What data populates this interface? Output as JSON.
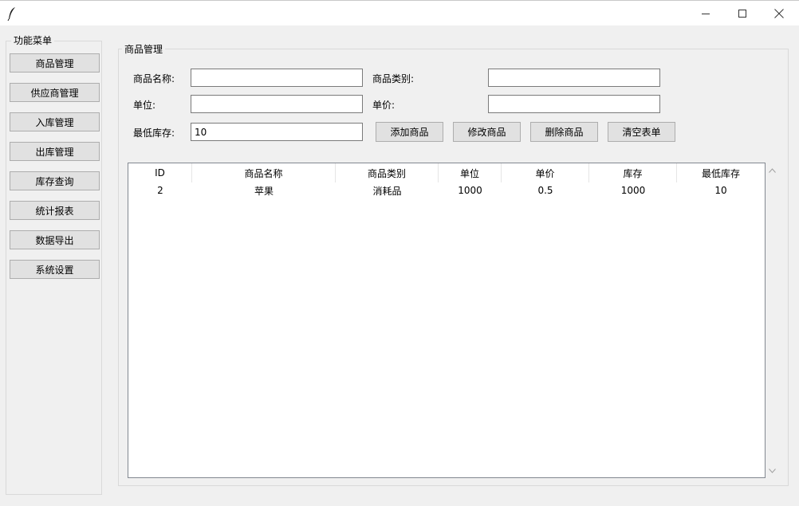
{
  "window": {
    "icon": "feather-icon",
    "minimize_icon": "minimize-icon",
    "maximize_icon": "maximize-icon",
    "close_icon": "close-icon"
  },
  "sidebar": {
    "title": "功能菜单",
    "items": [
      {
        "label": "商品管理"
      },
      {
        "label": "供应商管理"
      },
      {
        "label": "入库管理"
      },
      {
        "label": "出库管理"
      },
      {
        "label": "库存查询"
      },
      {
        "label": "统计报表"
      },
      {
        "label": "数据导出"
      },
      {
        "label": "系统设置"
      }
    ]
  },
  "main": {
    "title": "商品管理",
    "form": {
      "name_label": "商品名称:",
      "name_value": "",
      "category_label": "商品类别:",
      "category_value": "",
      "unit_label": "单位:",
      "unit_value": "",
      "price_label": "单价:",
      "price_value": "",
      "min_stock_label": "最低库存:",
      "min_stock_value": "10"
    },
    "actions": {
      "add": "添加商品",
      "edit": "修改商品",
      "delete": "删除商品",
      "clear": "清空表单"
    },
    "table": {
      "columns": [
        "ID",
        "商品名称",
        "商品类别",
        "单位",
        "单价",
        "库存",
        "最低库存"
      ],
      "rows": [
        [
          "2",
          "苹果",
          "消耗品",
          "1000",
          "0.5",
          "1000",
          "10"
        ]
      ]
    }
  }
}
